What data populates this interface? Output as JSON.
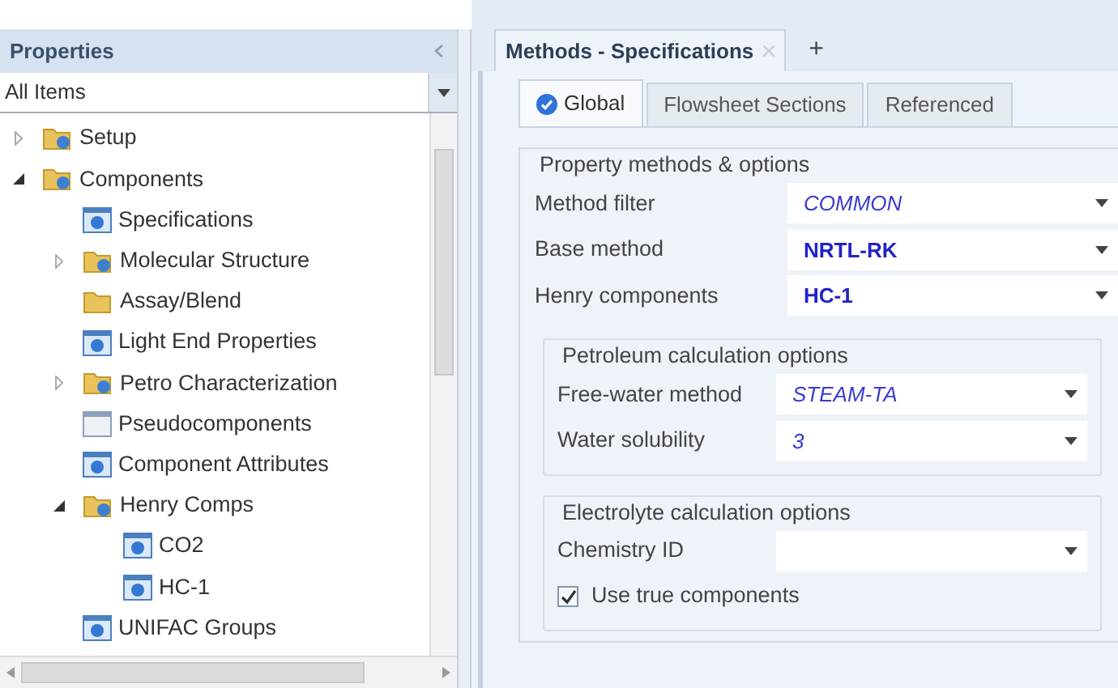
{
  "sidebar": {
    "title": "Properties",
    "filter": "All Items",
    "tree": [
      {
        "label": "Setup",
        "kind": "folder",
        "expanded": false
      },
      {
        "label": "Components",
        "kind": "folder",
        "expanded": true,
        "children": [
          {
            "label": "Specifications",
            "kind": "form"
          },
          {
            "label": "Molecular Structure",
            "kind": "folder",
            "expanded": false
          },
          {
            "label": "Assay/Blend",
            "kind": "plainfolder"
          },
          {
            "label": "Light End Properties",
            "kind": "form"
          },
          {
            "label": "Petro Characterization",
            "kind": "folder",
            "expanded": false
          },
          {
            "label": "Pseudocomponents",
            "kind": "blankform"
          },
          {
            "label": "Component Attributes",
            "kind": "form"
          },
          {
            "label": "Henry Comps",
            "kind": "folder",
            "expanded": true,
            "children": [
              {
                "label": "CO2",
                "kind": "form"
              },
              {
                "label": "HC-1",
                "kind": "form"
              }
            ]
          },
          {
            "label": "UNIFAC Groups",
            "kind": "form"
          }
        ]
      }
    ]
  },
  "document_tabs": [
    {
      "label": "Methods - Specifications",
      "selected": true
    }
  ],
  "new_tab": "+",
  "tabs": [
    {
      "label": "Global",
      "selected": true,
      "complete": true
    },
    {
      "label": "Flowsheet Sections",
      "selected": false,
      "complete": false
    },
    {
      "label": "Referenced",
      "selected": false,
      "complete": false
    }
  ],
  "groups": [
    {
      "title": "Property methods & options",
      "fields": [
        {
          "kind": "italic",
          "label": "Method filter",
          "value": "COMMON"
        },
        {
          "kind": "bold",
          "label": "Base method",
          "value": "NRTL-RK"
        },
        {
          "kind": "bold",
          "label": "Henry components",
          "value": "HC-1"
        }
      ],
      "groups": [
        {
          "title": "Petroleum calculation options",
          "fields": [
            {
              "kind": "italic",
              "label": "Free-water method",
              "value": "STEAM-TA"
            },
            {
              "kind": "italic",
              "label": "Water solubility",
              "value": "3"
            }
          ]
        },
        {
          "title": "Electrolyte calculation options",
          "fields": [
            {
              "kind": "empty",
              "label": "Chemistry ID"
            },
            {
              "kind": "checkbox",
              "label": "Use true components",
              "checked": true
            }
          ]
        }
      ]
    }
  ]
}
